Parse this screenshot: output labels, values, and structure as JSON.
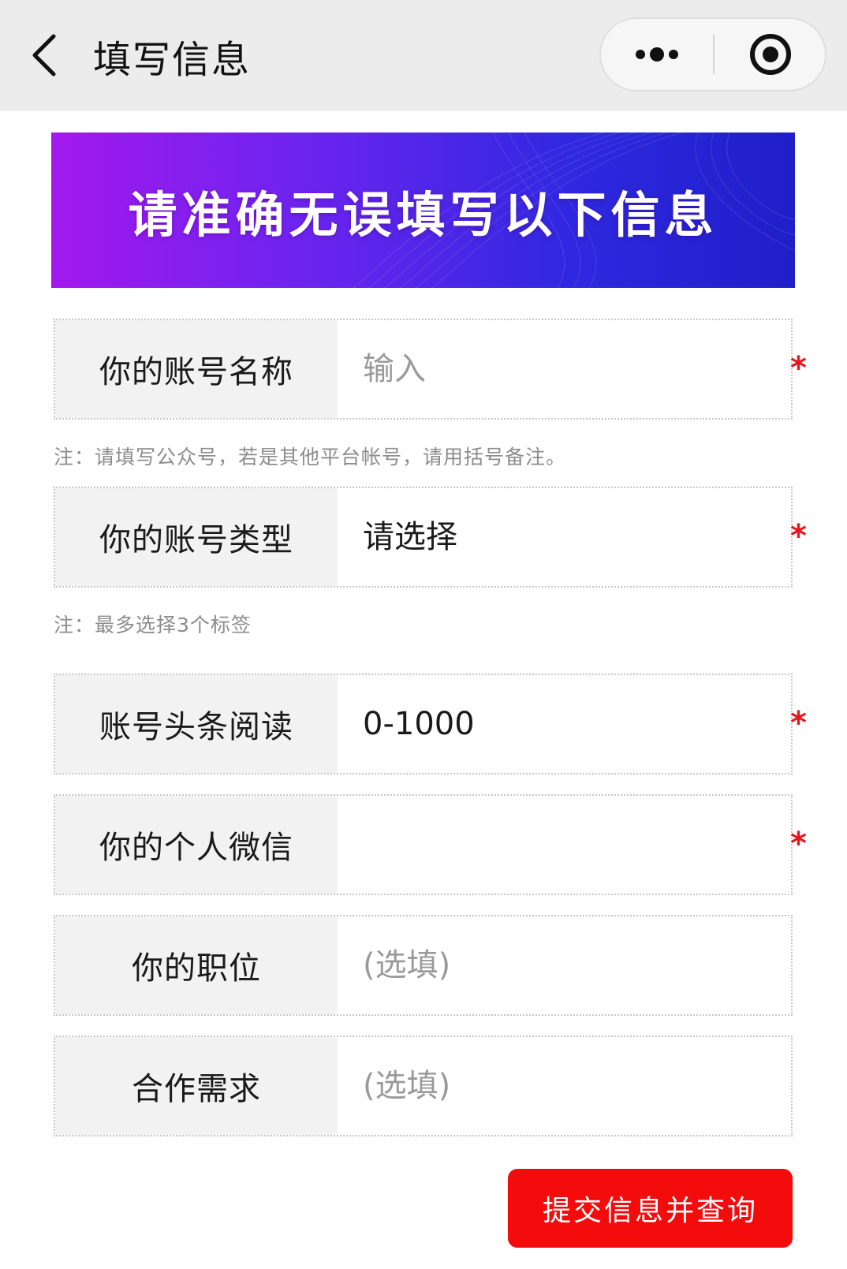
{
  "nav": {
    "title": "填写信息"
  },
  "banner": {
    "text": "请准确无误填写以下信息"
  },
  "form": {
    "fields": [
      {
        "label": "你的账号名称",
        "value": "输入",
        "is_placeholder": true,
        "required": "*"
      },
      {
        "label": "你的账号类型",
        "value": "请选择",
        "is_placeholder": false,
        "required": "*"
      },
      {
        "label": "账号头条阅读",
        "value": "0-1000",
        "is_placeholder": false,
        "required": "*"
      },
      {
        "label": "你的个人微信",
        "value": "",
        "is_placeholder": true,
        "required": "*"
      },
      {
        "label": "你的职位",
        "value": "(选填)",
        "is_placeholder": true,
        "required": ""
      },
      {
        "label": "合作需求",
        "value": "(选填)",
        "is_placeholder": true,
        "required": ""
      }
    ],
    "notes": {
      "account_name": "注：请填写公众号，若是其他平台帐号，请用括号备注。",
      "account_type": "注：最多选择3个标签"
    }
  },
  "submit": {
    "label": "提交信息并查询"
  },
  "colors": {
    "accent": "#f40b0b",
    "required_star": "#e8141c",
    "navbar_bg": "#ececec",
    "label_bg": "#f2f2f2",
    "banner_gradient": [
      "#a319ee",
      "#6b24ef",
      "#2f28e0",
      "#1f1fc9"
    ]
  },
  "icons": {
    "back": "chevron-left-icon",
    "more": "more-dots-icon",
    "close": "target-circle-icon"
  }
}
